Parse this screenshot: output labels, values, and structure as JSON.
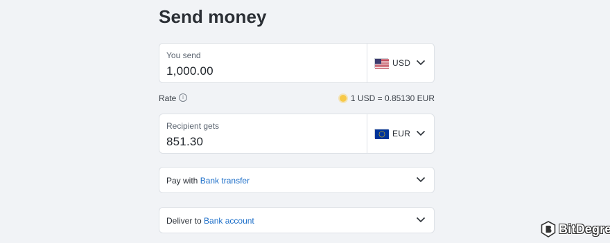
{
  "page": {
    "title": "Send money"
  },
  "send": {
    "label": "You send",
    "amount": "1,000.00",
    "currency": "USD",
    "flag_icon": "us-flag-icon"
  },
  "rate": {
    "label": "Rate",
    "value": "1 USD = 0.85130 EUR",
    "info_icon": "info-icon"
  },
  "receive": {
    "label": "Recipient gets",
    "amount": "851.30",
    "currency": "EUR",
    "flag_icon": "eu-flag-icon"
  },
  "pay_with": {
    "prefix": "Pay with",
    "value": "Bank transfer"
  },
  "deliver_to": {
    "prefix": "Deliver to",
    "value": "Bank account"
  },
  "watermark": {
    "brand": "BitDegree"
  },
  "colors": {
    "background": "#f1f3f6",
    "card": "#ffffff",
    "border": "#dde1e6",
    "link": "#1d6fc9",
    "accent_sun": "#f7c948"
  }
}
